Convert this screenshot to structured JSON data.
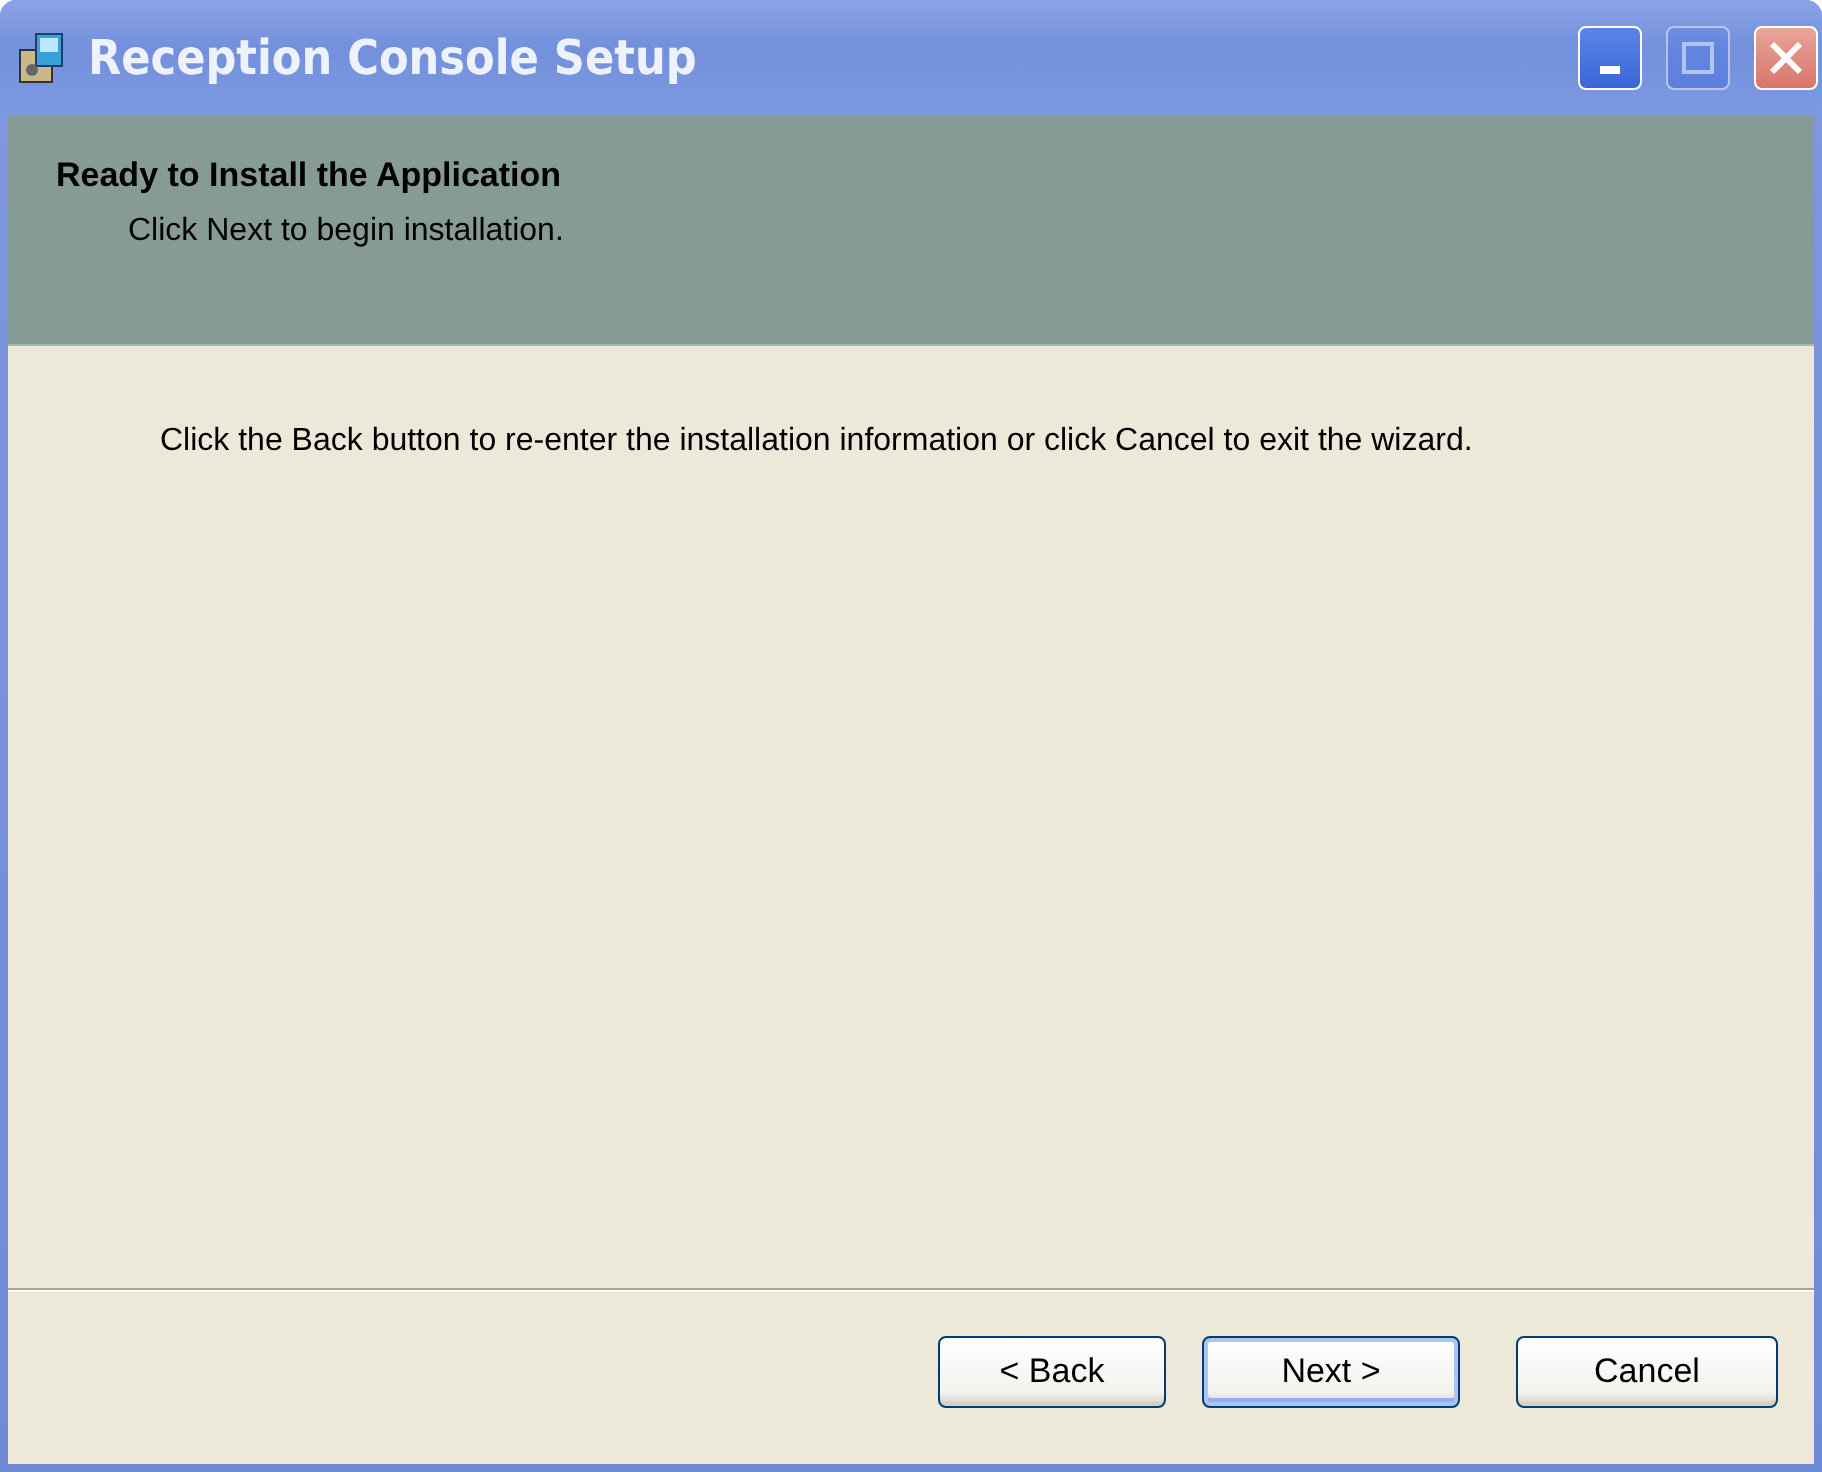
{
  "window": {
    "title": "Reception Console Setup",
    "controls": [
      {
        "kind": "minimize",
        "disabled": false
      },
      {
        "kind": "maximize",
        "disabled": true
      },
      {
        "kind": "close",
        "disabled": false
      }
    ]
  },
  "header": {
    "title": "Ready to Install the Application",
    "subtitle": "Click Next to begin installation."
  },
  "body": {
    "text": "Click the Back button to re-enter the installation information or click Cancel to exit the wizard."
  },
  "buttons": [
    {
      "label": "< Back",
      "default": false
    },
    {
      "label": "Next >",
      "default": true
    },
    {
      "label": "Cancel",
      "default": false
    }
  ]
}
